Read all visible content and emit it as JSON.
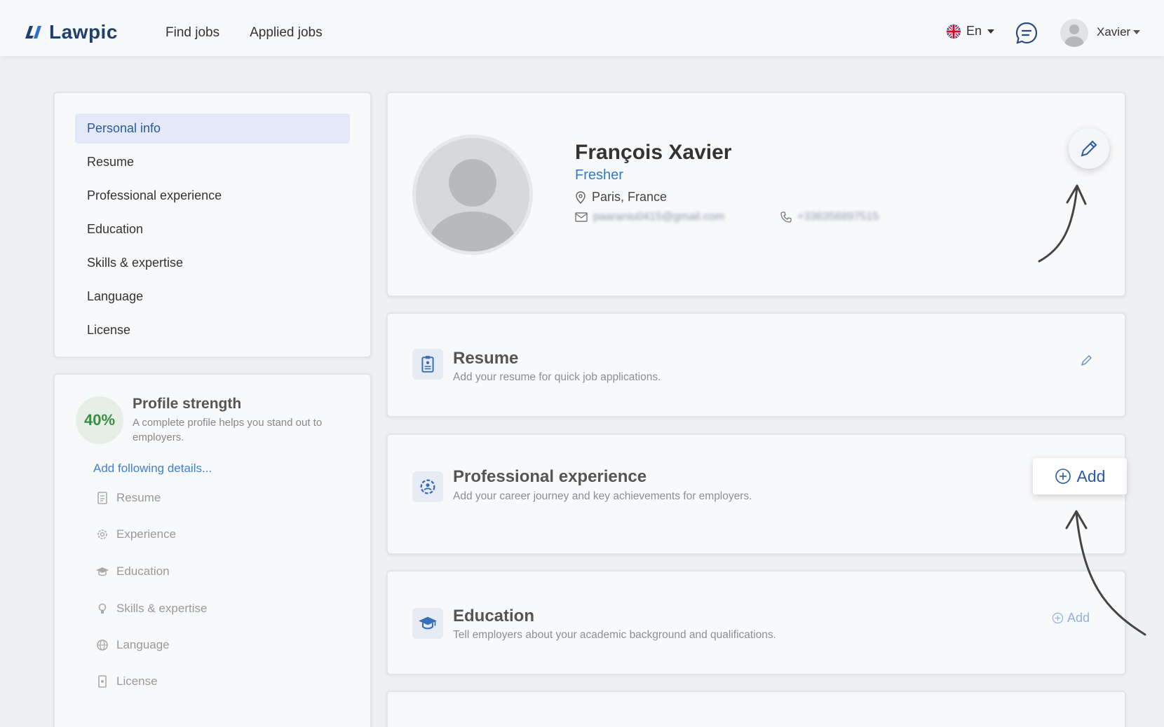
{
  "header": {
    "brand": "Lawpic",
    "nav": [
      "Find jobs",
      "Applied jobs"
    ],
    "language": "En",
    "user_name": "Xavier"
  },
  "sidebar": {
    "items": [
      {
        "label": "Personal info",
        "active": true
      },
      {
        "label": "Resume"
      },
      {
        "label": "Professional experience"
      },
      {
        "label": "Education"
      },
      {
        "label": "Skills & expertise"
      },
      {
        "label": "Language"
      },
      {
        "label": "License"
      }
    ]
  },
  "strength": {
    "percent": "40%",
    "title": "Profile strength",
    "description": "A complete profile helps you stand out to employers.",
    "add_label": "Add following details...",
    "details": [
      "Resume",
      "Experience",
      "Education",
      "Skills & expertise",
      "Language",
      "License"
    ]
  },
  "profile": {
    "name": "François Xavier",
    "role": "Fresher",
    "location": "Paris, France",
    "email": "paaraniu0415@gmail.com",
    "phone": "+336356897515"
  },
  "sections": {
    "resume": {
      "title": "Resume",
      "desc": "Add your resume for quick job applications."
    },
    "experience": {
      "title": "Professional experience",
      "desc": "Add your career journey and key achievements for employers.",
      "add_label": "Add"
    },
    "education": {
      "title": "Education",
      "desc": "Tell employers about your academic background and qualifications.",
      "add_label": "Add"
    }
  },
  "colors": {
    "accent": "#2a5aa0",
    "brand": "#1f3f6e",
    "success": "#3a8f43"
  }
}
